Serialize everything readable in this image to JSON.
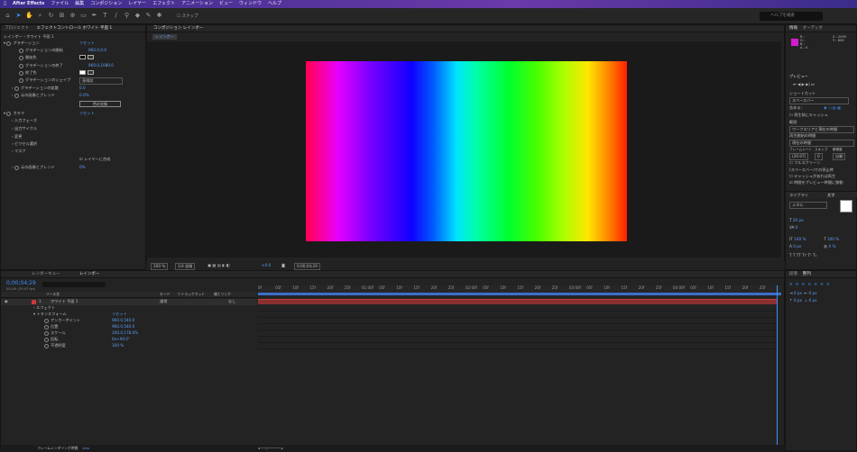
{
  "menu": {
    "items": [
      "After Effects",
      "ファイル",
      "編集",
      "コンポジション",
      "レイヤー",
      "エフェクト",
      "アニメーション",
      "ビュー",
      "ウィンドウ",
      "ヘルプ"
    ]
  },
  "toolbar": {
    "snap_label": "スナップ",
    "help_search_placeholder": "ヘルプを検索"
  },
  "project_panel": {
    "tab_project": "プロジェクト",
    "tab_effects": "エフェクトコントロール ホワイト 平面 1",
    "layer_path": "レインボー・ホワイト 平面 1"
  },
  "effects": {
    "gradient_name": "グラデーション",
    "gradient_value": "リセット",
    "start": {
      "label": "グラデーションの開始",
      "value": "960.0,0.0"
    },
    "start_color": {
      "label": "開始色"
    },
    "end": {
      "label": "グラデーションの終了",
      "value": "960.0,1080.0"
    },
    "end_color": {
      "label": "終了色"
    },
    "shape": {
      "label": "グラデーションのシェイプ",
      "value": "直線状"
    },
    "scatter": {
      "label": "グラデーションの拡散",
      "value": "0.0"
    },
    "blend": {
      "label": "元の画像とブレンド",
      "value": "0.0%"
    },
    "swap_button": "色の交換",
    "colorama_name": "カラマ",
    "colorama_value": "リセット",
    "input_phase": "入力フェーズ",
    "output_cycle": "出力サイクル",
    "modify": "変更",
    "pixel_select": "ピクセル選択",
    "masking": "マスク",
    "composite_layer": "レイヤーに合成",
    "colorama_blend": {
      "label": "元の画像とブレンド",
      "value": "0%"
    }
  },
  "composition": {
    "tab": "コンポジション レインボー",
    "sub_tab": "レインボー",
    "zoom": "200 %",
    "resolution": "1/4 画質",
    "exposure": "+0.0",
    "timecode": "0;00;04;29"
  },
  "right_panel": {
    "info_tab": "情報",
    "audio_tab": "オーディオ",
    "info_rows": [
      "R :",
      "G :",
      "B :",
      "A : 0",
      "X : 2095",
      "Y : 609"
    ],
    "preview_tab": "プレビュー",
    "shortcut_label": "ショートカット",
    "shortcut_value": "スペースバー",
    "include_label": "含める：",
    "cache_before": "再生前にキャッシュ",
    "range_label": "範囲",
    "range_value": "ワークエリアと現在の時間",
    "play_from_label": "再生開始の時間",
    "play_from_value": "現在の時間",
    "frame_rate_label": "フレームレート",
    "skip_label": "スキップ",
    "resolution_label": "解像度",
    "frame_rate_value": "(29.97)",
    "skip_value": "0",
    "resolution_value": "自動",
    "fullscreen": "フルスクリーン",
    "on_stop_label": "(スペースバー)での停止時",
    "cache_if": "キャッシュがあれば再生",
    "move_time": "時間をプレビュー時間に移動",
    "library_tab": "ライブラリ",
    "text_tab": "文字",
    "font_size": "20 px",
    "font_name": "メタル",
    "tracking": "0",
    "scale_v": "100 %",
    "scale_h": "100 %",
    "baseline": "0 px",
    "tsume": "0 %",
    "paragraph_tab": "段落",
    "align_tab": "整列"
  },
  "timeline": {
    "tab_render": "レンダーキュー",
    "tab_comp": "レインボー",
    "timecode": "0;00;04;29",
    "frame_info": "00149 (29.97 fps)",
    "columns": [
      "ソース名",
      "モード",
      "T トラックマット",
      "親とリンク"
    ],
    "layer_num": "1",
    "layer_name": "ホワイト 平面 1",
    "mode_value": "通常",
    "trkmat_value": "なし",
    "parent_value": "なし",
    "effects_label": "エフェクト",
    "transform_label": "トランスフォーム",
    "transform_value": "リセット",
    "props": [
      {
        "label": "アンカーポイント",
        "value": "960.0,540.0"
      },
      {
        "label": "位置",
        "value": "960.0,540.0"
      },
      {
        "label": "スケール",
        "value": "100.0,178.0%"
      },
      {
        "label": "回転",
        "value": "0x+90.0°"
      },
      {
        "label": "不透明度",
        "value": "100 %"
      }
    ],
    "ruler": [
      "0f",
      "05f",
      "10f",
      "15f",
      "20f",
      "25f",
      "01:00f",
      "05f",
      "10f",
      "15f",
      "20f",
      "25f",
      "02:00f",
      "05f",
      "10f",
      "15f",
      "20f",
      "25f",
      "03:00f",
      "05f",
      "10f",
      "15f",
      "20f",
      "25f",
      "04:00f",
      "05f",
      "10f",
      "15f",
      "20f",
      "25f"
    ],
    "footer_label": "フレームレンダリング時間",
    "footer_value": "1ms"
  },
  "colors": {
    "accent": "#3e8ef7",
    "purple": "#d51bd1",
    "red_track": "#c63a3a"
  }
}
